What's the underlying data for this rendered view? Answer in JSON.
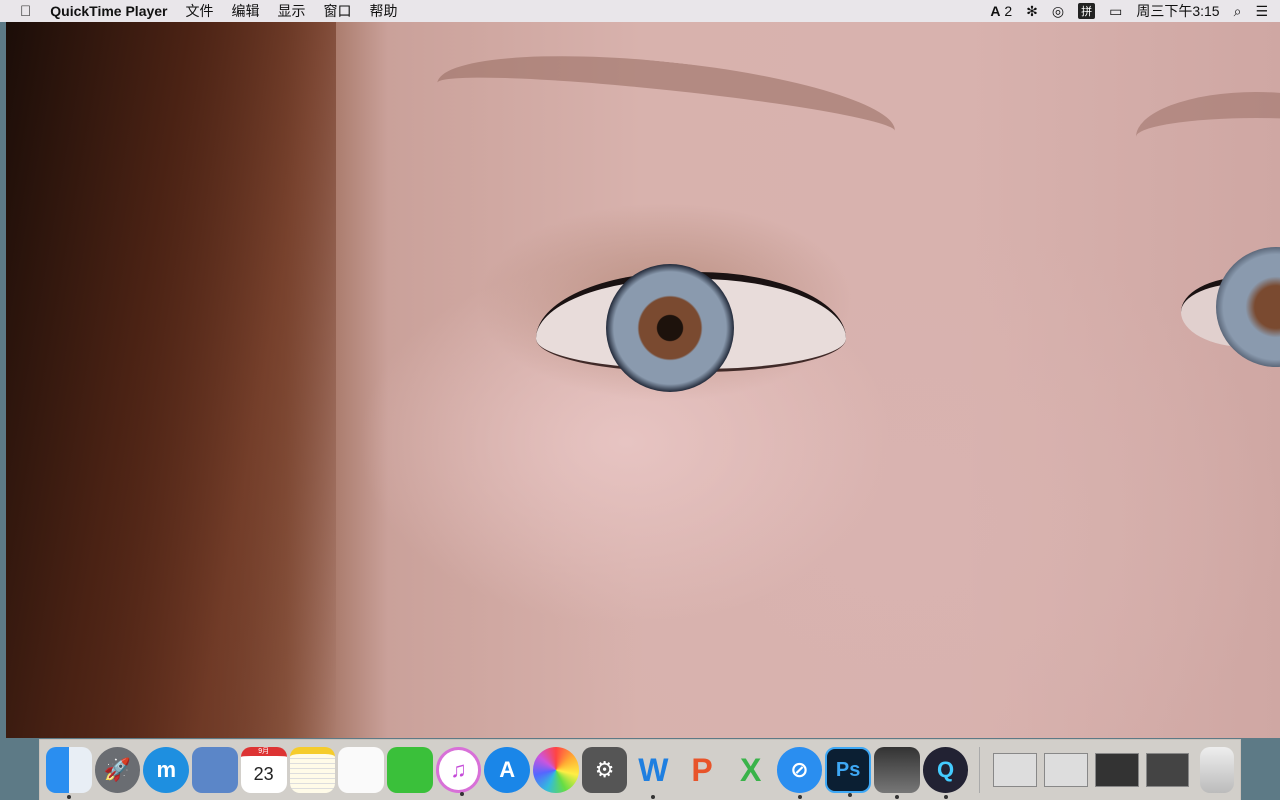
{
  "menubar": {
    "apple": "",
    "app": "QuickTime Player",
    "items": [
      "文件",
      "编辑",
      "显示",
      "窗口",
      "帮助"
    ],
    "status": {
      "adobe_label": "2",
      "ime": "拼",
      "clock": "周三下午3:15"
    }
  },
  "dock": {
    "apps": [
      {
        "name": "finder",
        "label": "",
        "running": true
      },
      {
        "name": "launchpad",
        "label": "",
        "running": false
      },
      {
        "name": "maxthon",
        "label": "m",
        "running": false
      },
      {
        "name": "mail",
        "label": "",
        "running": false
      },
      {
        "name": "calendar",
        "label": "23",
        "month": "9月",
        "running": false
      },
      {
        "name": "notes",
        "label": "",
        "running": false
      },
      {
        "name": "reminders",
        "label": "",
        "running": false
      },
      {
        "name": "facetime",
        "label": "",
        "running": false
      },
      {
        "name": "itunes",
        "label": "♫",
        "running": true
      },
      {
        "name": "app-store",
        "label": "A",
        "running": false
      },
      {
        "name": "photos",
        "label": "",
        "running": false
      },
      {
        "name": "system-preferences",
        "label": "⚙",
        "running": false
      },
      {
        "name": "wps-writer",
        "label": "W",
        "running": true
      },
      {
        "name": "wps-presentation",
        "label": "P",
        "running": false
      },
      {
        "name": "wps-spreadsheets",
        "label": "X",
        "running": false
      },
      {
        "name": "safari",
        "label": "⊘",
        "running": true
      },
      {
        "name": "photoshop",
        "label": "Ps",
        "running": true
      },
      {
        "name": "final-cut-pro",
        "label": "",
        "running": true
      },
      {
        "name": "quicktime",
        "label": "Q",
        "running": true
      }
    ]
  }
}
